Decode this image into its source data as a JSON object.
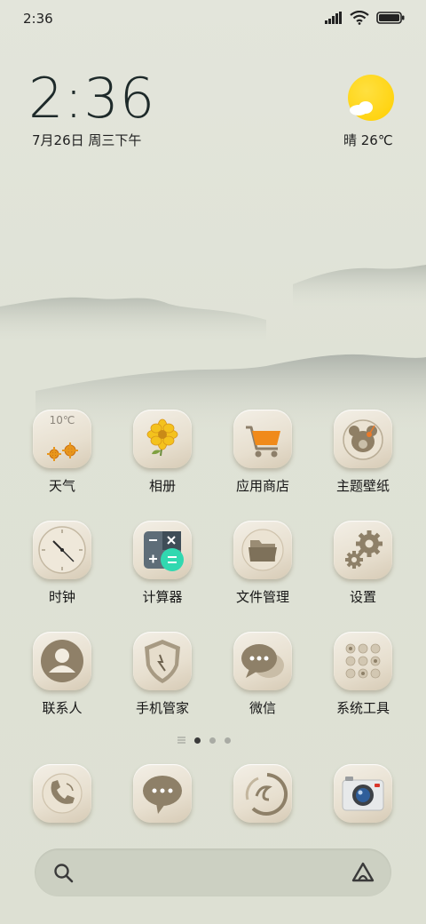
{
  "status_bar": {
    "time": "2:36"
  },
  "clock_widget": {
    "time": "2:36",
    "date": "7月26日 周三下午"
  },
  "weather_widget": {
    "text": "晴 26℃",
    "icon": "sunny-partly-cloudy-icon"
  },
  "apps": [
    {
      "label": "天气",
      "icon": "weather-icon",
      "temp": "10℃"
    },
    {
      "label": "相册",
      "icon": "gallery-icon"
    },
    {
      "label": "应用商店",
      "icon": "app-store-icon"
    },
    {
      "label": "主题壁纸",
      "icon": "themes-icon"
    },
    {
      "label": "时钟",
      "icon": "clock-icon"
    },
    {
      "label": "计算器",
      "icon": "calculator-icon"
    },
    {
      "label": "文件管理",
      "icon": "folder-icon"
    },
    {
      "label": "设置",
      "icon": "settings-gear-icon"
    },
    {
      "label": "联系人",
      "icon": "contacts-icon"
    },
    {
      "label": "手机管家",
      "icon": "security-shield-icon"
    },
    {
      "label": "微信",
      "icon": "wechat-icon"
    },
    {
      "label": "系统工具",
      "icon": "system-tools-icon"
    }
  ],
  "page_indicator": {
    "pages": 3,
    "active": 0
  },
  "dock": [
    {
      "icon": "phone-icon"
    },
    {
      "icon": "messages-icon"
    },
    {
      "icon": "browser-icon"
    },
    {
      "icon": "camera-icon"
    }
  ],
  "search_bar": {
    "search_icon": "search-icon",
    "assistant_icon": "assistant-icon"
  }
}
